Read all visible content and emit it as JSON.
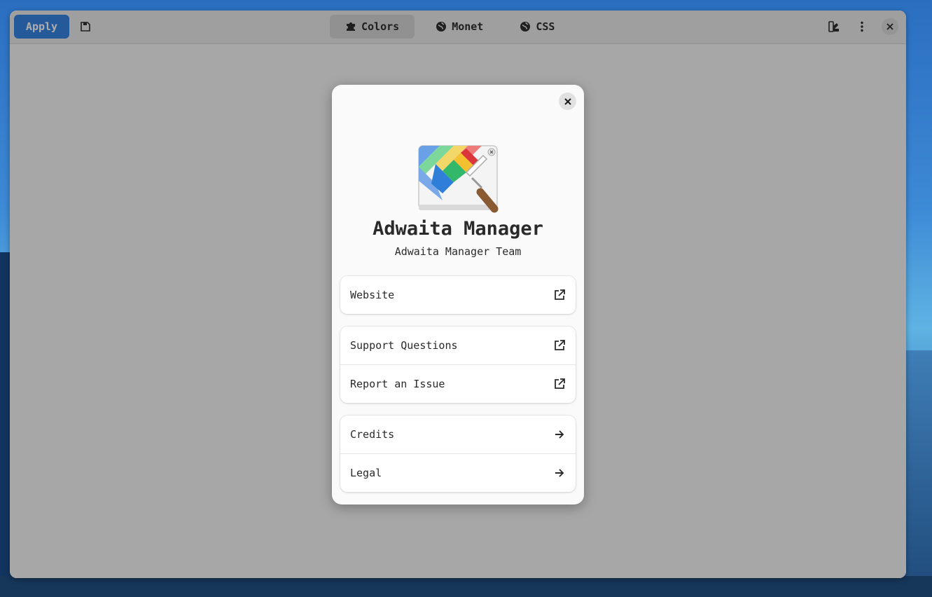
{
  "headerbar": {
    "apply_label": "Apply",
    "tabs": [
      {
        "label": "Colors",
        "icon": "puzzle-icon",
        "active": true
      },
      {
        "label": "Monet",
        "icon": "globe-icon",
        "active": false
      },
      {
        "label": "CSS",
        "icon": "globe-icon",
        "active": false
      }
    ]
  },
  "about": {
    "app_name": "Adwaita Manager",
    "developer": "Adwaita Manager Team",
    "groups": [
      [
        {
          "label": "Website",
          "icon": "external-link-icon"
        }
      ],
      [
        {
          "label": "Support Questions",
          "icon": "external-link-icon"
        },
        {
          "label": "Report an Issue",
          "icon": "external-link-icon"
        }
      ],
      [
        {
          "label": "Credits",
          "icon": "arrow-right-icon"
        },
        {
          "label": "Legal",
          "icon": "arrow-right-icon"
        }
      ]
    ]
  },
  "colors": {
    "accent": "#3584e4",
    "window_bg": "#fafafa",
    "headerbar_bg": "#ebebeb"
  }
}
